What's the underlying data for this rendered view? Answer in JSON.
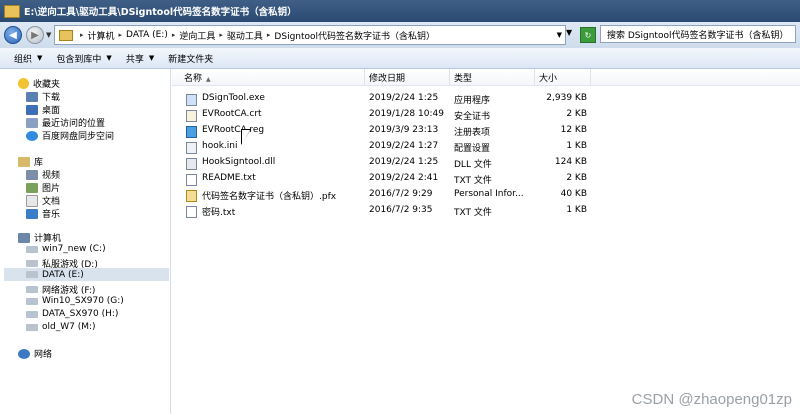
{
  "window": {
    "title": "E:\\逆向工具\\驱动工具\\DSigntool代码签名数字证书（含私钥）"
  },
  "address": {
    "crumbs": [
      "计算机",
      "DATA (E:)",
      "逆向工具",
      "驱动工具",
      "DSigntool代码签名数字证书（含私钥）"
    ]
  },
  "search": {
    "text": "搜索 DSigntool代码签名数字证书（含私钥）"
  },
  "toolbar": {
    "organize": "组织",
    "include_library": "包含到库中",
    "share": "共享",
    "new_folder": "新建文件夹"
  },
  "nav": {
    "favorites": {
      "header": "收藏夹",
      "items": [
        "下载",
        "桌面",
        "最近访问的位置",
        "百度网盘同步空间"
      ]
    },
    "libraries": {
      "header": "库",
      "items": [
        "视频",
        "图片",
        "文档",
        "音乐"
      ]
    },
    "computer": {
      "header": "计算机",
      "items": [
        "win7_new (C:)",
        "私服游戏 (D:)",
        "DATA (E:)",
        "网络游戏 (F:)",
        "Win10_SX970 (G:)",
        "DATA_SX970 (H:)",
        "old_W7 (M:)"
      ],
      "selected": "DATA (E:)"
    },
    "network": {
      "header": "网络"
    }
  },
  "columns": {
    "name": "名称",
    "date": "修改日期",
    "type": "类型",
    "size": "大小"
  },
  "files": [
    {
      "name": "DSignTool.exe",
      "date": "2019/2/24 1:25",
      "type": "应用程序",
      "size": "2,939 KB",
      "icon": "exe-icon"
    },
    {
      "name": "EVRootCA.crt",
      "date": "2019/1/28 10:49",
      "type": "安全证书",
      "size": "2 KB",
      "icon": "certificate-icon"
    },
    {
      "name": "EVRootCA.reg",
      "date": "2019/3/9 23:13",
      "type": "注册表项",
      "size": "12 KB",
      "icon": "registry-icon"
    },
    {
      "name": "hook.ini",
      "date": "2019/2/24 1:27",
      "type": "配置设置",
      "size": "1 KB",
      "icon": "config-icon"
    },
    {
      "name": "HookSigntool.dll",
      "date": "2019/2/24 1:25",
      "type": "DLL 文件",
      "size": "124 KB",
      "icon": "dll-icon"
    },
    {
      "name": "README.txt",
      "date": "2019/2/24 2:41",
      "type": "TXT 文件",
      "size": "2 KB",
      "icon": "text-file-icon"
    },
    {
      "name": "代码签名数字证书（含私钥）.pfx",
      "date": "2016/7/2 9:29",
      "type": "Personal Infor...",
      "size": "40 KB",
      "icon": "pfx-icon"
    },
    {
      "name": "密码.txt",
      "date": "2016/7/2 9:35",
      "type": "TXT 文件",
      "size": "1 KB",
      "icon": "text-file-icon"
    }
  ],
  "watermark": "CSDN @zhaopeng01zp"
}
